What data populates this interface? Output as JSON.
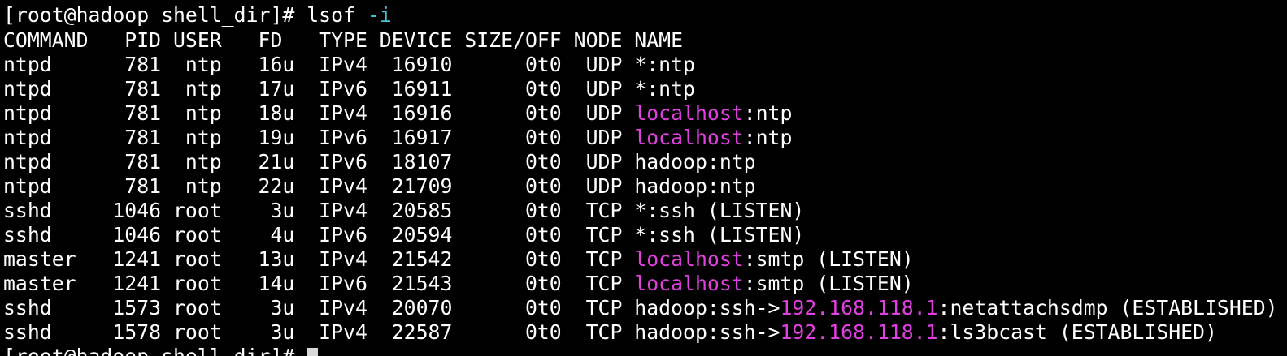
{
  "terminal": {
    "prompt": "[root@hadoop shell_dir]#",
    "command": "lsof",
    "command_option": "-i",
    "last_prompt_partial": "[root@hadoop shell_dir]#",
    "header": "COMMAND   PID USER   FD   TYPE DEVICE SIZE/OFF NODE NAME",
    "rows": [
      {
        "pre": "ntpd      781  ntp   16u  IPv4  16910      0t0  UDP ",
        "host": "",
        "post": "*:ntp"
      },
      {
        "pre": "ntpd      781  ntp   17u  IPv6  16911      0t0  UDP ",
        "host": "",
        "post": "*:ntp"
      },
      {
        "pre": "ntpd      781  ntp   18u  IPv4  16916      0t0  UDP ",
        "host": "localhost",
        "post": ":ntp"
      },
      {
        "pre": "ntpd      781  ntp   19u  IPv6  16917      0t0  UDP ",
        "host": "localhost",
        "post": ":ntp"
      },
      {
        "pre": "ntpd      781  ntp   21u  IPv6  18107      0t0  UDP ",
        "host": "",
        "post": "hadoop:ntp"
      },
      {
        "pre": "ntpd      781  ntp   22u  IPv4  21709      0t0  UDP ",
        "host": "",
        "post": "hadoop:ntp"
      },
      {
        "pre": "sshd     1046 root    3u  IPv4  20585      0t0  TCP ",
        "host": "",
        "post": "*:ssh (LISTEN)"
      },
      {
        "pre": "sshd     1046 root    4u  IPv6  20594      0t0  TCP ",
        "host": "",
        "post": "*:ssh (LISTEN)"
      },
      {
        "pre": "master   1241 root   13u  IPv4  21542      0t0  TCP ",
        "host": "localhost",
        "post": ":smtp (LISTEN)"
      },
      {
        "pre": "master   1241 root   14u  IPv6  21543      0t0  TCP ",
        "host": "localhost",
        "post": ":smtp (LISTEN)"
      },
      {
        "pre": "sshd     1573 root    3u  IPv4  20070      0t0  TCP hadoop:ssh->",
        "host": "192.168.118.1",
        "post": ":netattachsdmp (ESTABLISHED)"
      },
      {
        "pre": "sshd     1578 root    3u  IPv4  22587      0t0  TCP hadoop:ssh->",
        "host": "192.168.118.1",
        "post": ":ls3bcast (ESTABLISHED)"
      }
    ],
    "colors": {
      "background": "#000000",
      "foreground": "#ffffff",
      "highlight": "#e040e0",
      "option": "#3cc8d8"
    }
  }
}
